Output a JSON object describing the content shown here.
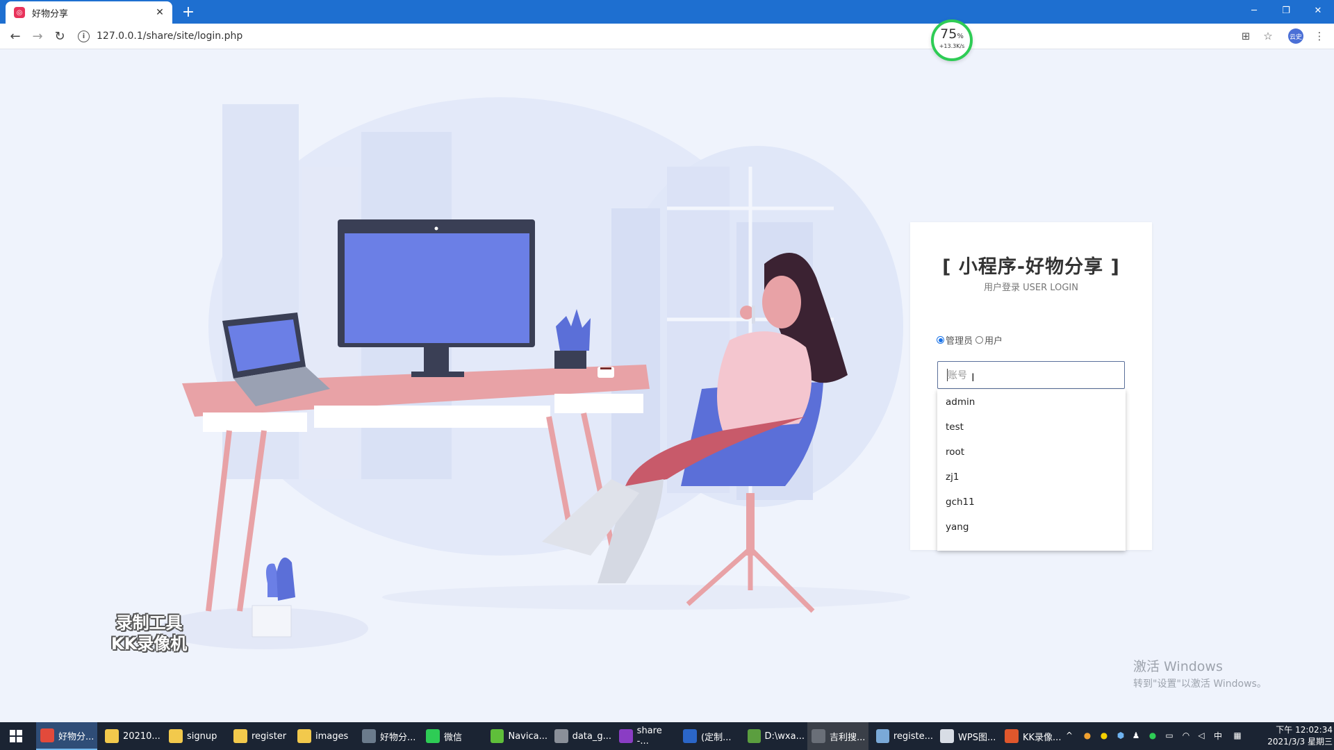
{
  "browser": {
    "tab_title": "好物分享",
    "favicon_glyph": "◎",
    "url": "127.0.0.1/share/site/login.php",
    "profile_label": "云史"
  },
  "speed_gauge": {
    "percent": "75",
    "unit": "%",
    "speed": "+13.3K/s",
    "color": "#2ecc55"
  },
  "login": {
    "title": "[ 小程序-好物分享 ]",
    "subtitle": "用户登录 USER LOGIN",
    "roles": [
      {
        "label": "管理员",
        "selected": true
      },
      {
        "label": "用户",
        "selected": false
      }
    ],
    "account_placeholder": "账号",
    "suggestions": [
      "admin",
      "test",
      "root",
      "zj1",
      "gch11",
      "yang"
    ]
  },
  "watermark": {
    "line1": "录制工具",
    "line2": "KK录像机"
  },
  "activation": {
    "line1": "激活 Windows",
    "line2": "转到\"设置\"以激活 Windows。"
  },
  "taskbar": {
    "items": [
      {
        "label": "好物分...",
        "icon": "chrome-icon",
        "color": "#e24a3b",
        "state": "active"
      },
      {
        "label": "20210...",
        "icon": "folder-icon",
        "color": "#f2c94c",
        "state": "normal"
      },
      {
        "label": "signup",
        "icon": "folder-icon",
        "color": "#f2c94c",
        "state": "normal"
      },
      {
        "label": "register",
        "icon": "folder-icon",
        "color": "#f2c94c",
        "state": "normal"
      },
      {
        "label": "images",
        "icon": "folder-icon",
        "color": "#f2c94c",
        "state": "normal"
      },
      {
        "label": "好物分...",
        "icon": "wechat-devtools-icon",
        "color": "#6b7b8c",
        "state": "normal"
      },
      {
        "label": "微信",
        "icon": "wechat-icon",
        "color": "#2ecc55",
        "state": "normal"
      },
      {
        "label": "Navica...",
        "icon": "navicat-icon",
        "color": "#5fbf3a",
        "state": "normal"
      },
      {
        "label": "data_g...",
        "icon": "database-icon",
        "color": "#8a8f99",
        "state": "normal"
      },
      {
        "label": "share -...",
        "icon": "phpstorm-icon",
        "color": "#8a3dc4",
        "state": "normal"
      },
      {
        "label": "(定制...",
        "icon": "word-icon",
        "color": "#2b66c8",
        "state": "normal"
      },
      {
        "label": "D:\\wxa...",
        "icon": "notepad-icon",
        "color": "#5b9e3f",
        "state": "normal"
      },
      {
        "label": "吉利搜...",
        "icon": "browser-icon",
        "color": "#6a6f78",
        "state": "pressed"
      },
      {
        "label": "registe...",
        "icon": "editor-icon",
        "color": "#7aa9d8",
        "state": "normal"
      },
      {
        "label": "WPS图...",
        "icon": "wps-image-icon",
        "color": "#d8dde5",
        "state": "normal"
      },
      {
        "label": "KK录像...",
        "icon": "kk-recorder-icon",
        "color": "#e0572c",
        "state": "normal"
      }
    ],
    "ime": "中",
    "time": "下午 12:02:34",
    "date": "2021/3/3 星期三"
  },
  "colors": {
    "tabbar": "#1e6fd0",
    "accent": "#1a73e8",
    "monitor_screen": "#6b7fe6",
    "desk": "#e8a2a6",
    "chair": "#5b6fd8"
  }
}
